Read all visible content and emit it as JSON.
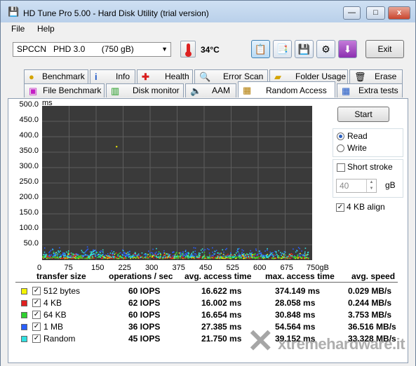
{
  "window": {
    "title": "HD Tune Pro 5.00 - Hard Disk Utility (trial version)",
    "app_icon": "hd-tune-icon",
    "controls": {
      "minimize": "—",
      "maximize": "□",
      "close": "x"
    }
  },
  "menu": {
    "file": "File",
    "help": "Help"
  },
  "toolbar": {
    "drive": "SPCCN   PHD 3.0       (750 gB)",
    "temperature": "34°C",
    "exit_label": "Exit",
    "icons": [
      "copy-info-icon",
      "copy-screenshot-icon",
      "save-icon",
      "options-icon",
      "download-icon"
    ]
  },
  "tabs_top": [
    {
      "label": "Benchmark",
      "icon": "benchmark-icon"
    },
    {
      "label": "Info",
      "icon": "info-icon"
    },
    {
      "label": "Health",
      "icon": "health-icon"
    },
    {
      "label": "Error Scan",
      "icon": "error-scan-icon"
    },
    {
      "label": "Folder Usage",
      "icon": "folder-icon"
    },
    {
      "label": "Erase",
      "icon": "erase-icon"
    }
  ],
  "tabs_bottom": [
    {
      "label": "File Benchmark",
      "icon": "file-benchmark-icon"
    },
    {
      "label": "Disk monitor",
      "icon": "disk-monitor-icon"
    },
    {
      "label": "AAM",
      "icon": "speaker-icon"
    },
    {
      "label": "Random Access",
      "icon": "random-access-icon",
      "active": true
    },
    {
      "label": "Extra tests",
      "icon": "extra-tests-icon"
    }
  ],
  "controls": {
    "start_label": "Start",
    "read_label": "Read",
    "write_label": "Write",
    "mode_selected": "Read",
    "short_stroke_label": "Short stroke",
    "short_stroke_checked": false,
    "short_stroke_value": "40",
    "short_stroke_unit": "gB",
    "align_label": "4 KB align",
    "align_checked": true
  },
  "chart_data": {
    "type": "scatter",
    "ylabel": "ms",
    "xlabel": "",
    "y_ticks": [
      "500.0",
      "450.0",
      "400.0",
      "350.0",
      "300.0",
      "250.0",
      "200.0",
      "150.0",
      "100.0",
      "50.0"
    ],
    "x_ticks": [
      "0",
      "75",
      "150",
      "225",
      "300",
      "375",
      "450",
      "525",
      "600",
      "675",
      "750gB"
    ],
    "xlim": [
      0,
      750
    ],
    "ylim": [
      0,
      500
    ],
    "grid": true,
    "background": "#3a3a3a",
    "series": [
      {
        "name": "512 bytes",
        "color": "#f4f400",
        "y_range": [
          5,
          25
        ]
      },
      {
        "name": "4 KB",
        "color": "#e02020",
        "y_range": [
          5,
          25
        ]
      },
      {
        "name": "64 KB",
        "color": "#30d030",
        "y_range": [
          5,
          28
        ]
      },
      {
        "name": "1 MB",
        "color": "#2a5fff",
        "y_range": [
          12,
          45
        ]
      },
      {
        "name": "Random",
        "color": "#30e0e0",
        "y_range": [
          8,
          40
        ]
      }
    ],
    "outliers": [
      {
        "x": 205,
        "y": 370
      }
    ]
  },
  "results": {
    "headers": [
      "transfer size",
      "operations / sec",
      "avg. access time",
      "max. access time",
      "avg. speed"
    ],
    "rows": [
      {
        "name": "512 bytes",
        "color": "#f4f400",
        "ops": "60 IOPS",
        "avg": "16.622 ms",
        "max": "374.149 ms",
        "speed": "0.029 MB/s"
      },
      {
        "name": "4 KB",
        "color": "#e02020",
        "ops": "62 IOPS",
        "avg": "16.002 ms",
        "max": "28.058 ms",
        "speed": "0.244 MB/s"
      },
      {
        "name": "64 KB",
        "color": "#30d030",
        "ops": "60 IOPS",
        "avg": "16.654 ms",
        "max": "30.848 ms",
        "speed": "3.753 MB/s"
      },
      {
        "name": "1 MB",
        "color": "#2a5fff",
        "ops": "36 IOPS",
        "avg": "27.385 ms",
        "max": "54.564 ms",
        "speed": "36.516 MB/s"
      },
      {
        "name": "Random",
        "color": "#30e0e0",
        "ops": "45 IOPS",
        "avg": "21.750 ms",
        "max": "39.152 ms",
        "speed": "33.328 MB/s"
      }
    ]
  },
  "watermark": {
    "text": "xtremehardware.it"
  }
}
